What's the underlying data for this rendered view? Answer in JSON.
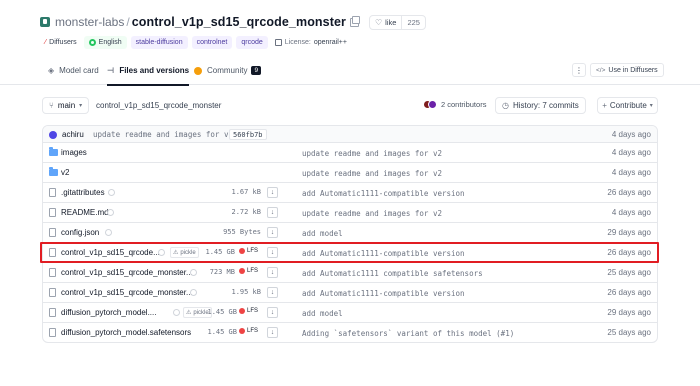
{
  "header": {
    "org": "monster-labs",
    "separator": "/",
    "repo": "control_v1p_sd15_qrcode_monster",
    "like_label": "like",
    "like_count": "225"
  },
  "tags": [
    {
      "label": "Diffusers",
      "icon": "diffusers-icon"
    },
    {
      "label": "English",
      "icon": "globe-icon"
    },
    {
      "label": "stable-diffusion"
    },
    {
      "label": "controlnet"
    },
    {
      "label": "qrcode"
    }
  ],
  "license": {
    "label": "License:",
    "value": "openrail++"
  },
  "tabs": [
    {
      "label": "Model card",
      "icon": "model-card-icon",
      "active": false
    },
    {
      "label": "Files and versions",
      "icon": "files-icon",
      "active": true
    },
    {
      "label": "Community",
      "icon": "community-icon",
      "badge": "9",
      "active": false
    }
  ],
  "actions": {
    "kebab": "⋮",
    "use_in": "Use in Diffusers"
  },
  "toolbar": {
    "branch": "main",
    "path": "control_v1p_sd15_qrcode_monster",
    "contributors": "2 contributors",
    "history": "History: 7 commits",
    "contribute": "Contribute"
  },
  "commit": {
    "user": "achiru",
    "message": "update readme and images for v2",
    "hash": "560fb7b",
    "date": "4 days ago"
  },
  "files": [
    {
      "type": "folder",
      "name": "images",
      "message": "update readme and images for v2",
      "date": "4 days ago"
    },
    {
      "type": "folder",
      "name": "v2",
      "message": "update readme and images for v2",
      "date": "4 days ago"
    },
    {
      "type": "file",
      "name": ".gitattributes",
      "size": "1.67 kB",
      "message": "add Automatic1111-compatible version",
      "date": "26 days ago"
    },
    {
      "type": "file",
      "name": "README.md",
      "size": "2.72 kB",
      "message": "update readme and images for v2",
      "date": "4 days ago"
    },
    {
      "type": "file",
      "name": "config.json",
      "size": "955 Bytes",
      "message": "add model",
      "date": "29 days ago"
    },
    {
      "type": "file",
      "name": "control_v1p_sd15_qrcode...",
      "pickle": "pickle",
      "size": "1.45 GB",
      "lfs": "LFS",
      "message": "add Automatic1111-compatible version",
      "date": "26 days ago"
    },
    {
      "type": "file",
      "name": "control_v1p_sd15_qrcode_monster...",
      "size": "723 MB",
      "lfs": "LFS",
      "message": "add Automatic1111 compatible safetensors",
      "date": "25 days ago"
    },
    {
      "type": "file",
      "name": "control_v1p_sd15_qrcode_monster...",
      "size": "1.95 kB",
      "message": "add Automatic1111-compatible version",
      "date": "26 days ago"
    },
    {
      "type": "file",
      "name": "diffusion_pytorch_model....",
      "pickle": "pickle",
      "size": "1.45 GB",
      "lfs": "LFS",
      "message": "add model",
      "date": "29 days ago"
    },
    {
      "type": "file",
      "name": "diffusion_pytorch_model.safetensors",
      "size": "1.45 GB",
      "lfs": "LFS",
      "message": "Adding `safetensors` variant of this model (#1)",
      "date": "25 days ago"
    }
  ],
  "highlight_color": "#e11d23"
}
